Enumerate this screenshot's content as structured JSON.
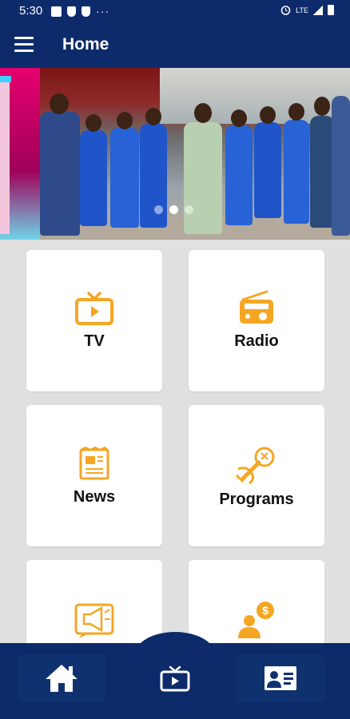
{
  "status_bar": {
    "time": "5:30",
    "icons": [
      "gallery-icon",
      "shield-icon",
      "shield-icon",
      "more-dots-icon",
      "alarm-icon",
      "signal-icon",
      "battery-icon"
    ],
    "network_label": "LTE"
  },
  "app_bar": {
    "title": "Home",
    "menu_icon": "hamburger-menu-icon"
  },
  "banner": {
    "slides": 3,
    "active_slide": 2
  },
  "tiles": [
    {
      "label": "TV",
      "icon": "tv-icon"
    },
    {
      "label": "Radio",
      "icon": "radio-icon"
    },
    {
      "label": "News",
      "icon": "newspaper-icon"
    },
    {
      "label": "Programs",
      "icon": "microphone-icon"
    },
    {
      "label": "",
      "icon": "megaphone-icon"
    },
    {
      "label": "",
      "icon": "advertise-person-dollar-icon"
    }
  ],
  "bottom_nav": [
    {
      "name": "home",
      "icon": "home-icon"
    },
    {
      "name": "tv",
      "icon": "tv-icon"
    },
    {
      "name": "contact",
      "icon": "contact-card-icon"
    }
  ],
  "colors": {
    "primary": "#0d2a6b",
    "accent": "#f5a623",
    "background": "#e0e0e0",
    "card": "#ffffff"
  }
}
